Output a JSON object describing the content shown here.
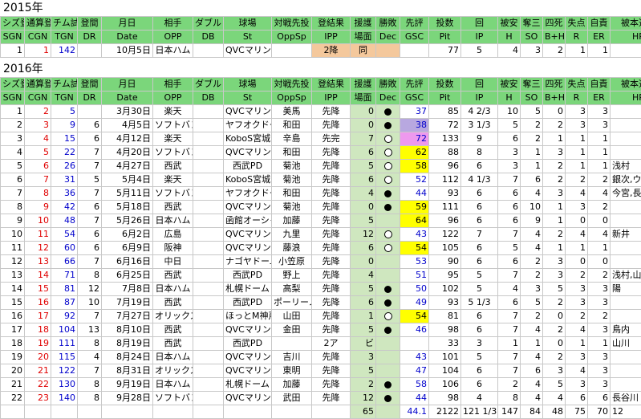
{
  "headings": {
    "y2015": "2015年",
    "y2016": "2016年"
  },
  "header_top": [
    "シズ登",
    "通算登",
    "チム試",
    "登間",
    "月日",
    "相手",
    "ダブル",
    "球場",
    "対戦先投",
    "登結果",
    "援護",
    "勝敗",
    "先評",
    "投数",
    "回",
    "被安",
    "奪三",
    "四死",
    "失点",
    "自責",
    "被本選手"
  ],
  "header_bottom": [
    "SGN",
    "CGN",
    "TGN",
    "DR",
    "Date",
    "OPP",
    "DB",
    "St",
    "OppSp",
    "IPP",
    "場面",
    "Dec",
    "GSC",
    "Pit",
    "IP",
    "H",
    "SO",
    "B+H",
    "R",
    "ER",
    "HR"
  ],
  "rows_2015": [
    {
      "sgn": "1",
      "cgn": "1",
      "tgn": "142",
      "dr": "",
      "date": "10月5日",
      "opp": "日本ハム",
      "db": "",
      "st": "QVCマリン",
      "oppsp": "",
      "ipp": "2降",
      "sc": "同",
      "dec": "",
      "gsc": "",
      "pit": "77",
      "ip": "5",
      "h": "4",
      "so": "3",
      "bh": "2",
      "r": "1",
      "er": "1",
      "hr": ""
    }
  ],
  "rows_2016": [
    {
      "sgn": "1",
      "cgn": "2",
      "tgn": "5",
      "dr": "",
      "date": "3月30日",
      "opp": "楽天",
      "db": "",
      "st": "QVCマリン",
      "oppsp": "美馬",
      "ipp": "先降",
      "sc": "0",
      "dec": "black",
      "gsc": "37",
      "gscbg": "",
      "pit": "85",
      "ip": "4 2/3",
      "h": "10",
      "so": "5",
      "bh": "0",
      "r": "3",
      "er": "3",
      "hr": ""
    },
    {
      "sgn": "2",
      "cgn": "3",
      "tgn": "9",
      "dr": "6",
      "date": "4月5日",
      "opp": "ソフトバンク",
      "db": "",
      "st": "ヤフオクドーム",
      "oppsp": "和田",
      "ipp": "先降",
      "sc": "0",
      "dec": "black",
      "gsc": "38",
      "gscbg": "lav",
      "pit": "72",
      "ip": "3 1/3",
      "h": "5",
      "so": "2",
      "bh": "2",
      "r": "3",
      "er": "3",
      "hr": ""
    },
    {
      "sgn": "3",
      "cgn": "4",
      "tgn": "15",
      "dr": "6",
      "date": "4月12日",
      "opp": "楽天",
      "db": "",
      "st": "KoboS宮城",
      "oppsp": "辛島",
      "ipp": "先完",
      "sc": "7",
      "dec": "white",
      "gsc": "72",
      "gscbg": "pink",
      "pit": "133",
      "ip": "9",
      "h": "6",
      "so": "2",
      "bh": "1",
      "r": "1",
      "er": "1",
      "hr": ""
    },
    {
      "sgn": "4",
      "cgn": "5",
      "tgn": "22",
      "dr": "7",
      "date": "4月20日",
      "opp": "ソフトバンク",
      "db": "",
      "st": "QVCマリン",
      "oppsp": "和田",
      "ipp": "先降",
      "sc": "6",
      "dec": "white",
      "gsc": "62",
      "gscbg": "yellow",
      "pit": "88",
      "ip": "8",
      "h": "3",
      "so": "1",
      "bh": "3",
      "r": "1",
      "er": "1",
      "hr": ""
    },
    {
      "sgn": "5",
      "cgn": "6",
      "tgn": "26",
      "dr": "7",
      "date": "4月27日",
      "opp": "西武",
      "db": "",
      "st": "西武PD",
      "oppsp": "菊池",
      "ipp": "先降",
      "sc": "5",
      "dec": "white",
      "gsc": "58",
      "gscbg": "yellow",
      "pit": "96",
      "ip": "6",
      "h": "3",
      "so": "1",
      "bh": "2",
      "r": "1",
      "er": "1",
      "hr": "浅村"
    },
    {
      "sgn": "6",
      "cgn": "7",
      "tgn": "31",
      "dr": "5",
      "date": "5月4日",
      "opp": "楽天",
      "db": "",
      "st": "KoboS宮城",
      "oppsp": "菊池",
      "ipp": "先降",
      "sc": "6",
      "dec": "white",
      "gsc": "52",
      "gscbg": "",
      "pit": "112",
      "ip": "4 1/3",
      "h": "7",
      "so": "6",
      "bh": "2",
      "r": "2",
      "er": "2",
      "hr": "銀次,ウィーラー"
    },
    {
      "sgn": "7",
      "cgn": "8",
      "tgn": "36",
      "dr": "7",
      "date": "5月11日",
      "opp": "ソフトバンク",
      "db": "",
      "st": "ヤフオクドーム",
      "oppsp": "和田",
      "ipp": "先降",
      "sc": "4",
      "dec": "black",
      "gsc": "44",
      "gscbg": "",
      "pit": "93",
      "ip": "6",
      "h": "6",
      "so": "4",
      "bh": "3",
      "r": "4",
      "er": "4",
      "hr": "今宮,長谷川"
    },
    {
      "sgn": "8",
      "cgn": "9",
      "tgn": "42",
      "dr": "6",
      "date": "5月18日",
      "opp": "西武",
      "db": "",
      "st": "QVCマリン",
      "oppsp": "菊池",
      "ipp": "先降",
      "sc": "0",
      "dec": "black",
      "gsc": "59",
      "gscbg": "yellow",
      "pit": "111",
      "ip": "6",
      "h": "6",
      "so": "10",
      "bh": "1",
      "r": "3",
      "er": "2",
      "hr": ""
    },
    {
      "sgn": "9",
      "cgn": "10",
      "tgn": "48",
      "dr": "7",
      "date": "5月26日",
      "opp": "日本ハム",
      "db": "",
      "st": "函館オーシャン",
      "oppsp": "加藤",
      "ipp": "先降",
      "sc": "5",
      "dec": "",
      "gsc": "64",
      "gscbg": "yellow",
      "pit": "96",
      "ip": "6",
      "h": "6",
      "so": "9",
      "bh": "1",
      "r": "0",
      "er": "0",
      "hr": ""
    },
    {
      "sgn": "10",
      "cgn": "11",
      "tgn": "54",
      "dr": "6",
      "date": "6月2日",
      "opp": "広島",
      "db": "",
      "st": "QVCマリン",
      "oppsp": "九里",
      "ipp": "先降",
      "sc": "12",
      "dec": "white",
      "gsc": "43",
      "gscbg": "",
      "pit": "122",
      "ip": "7",
      "h": "7",
      "so": "4",
      "bh": "2",
      "r": "4",
      "er": "4",
      "hr": "新井"
    },
    {
      "sgn": "11",
      "cgn": "12",
      "tgn": "60",
      "dr": "6",
      "date": "6月9日",
      "opp": "阪神",
      "db": "",
      "st": "QVCマリン",
      "oppsp": "藤浪",
      "ipp": "先降",
      "sc": "6",
      "dec": "white",
      "gsc": "54",
      "gscbg": "yellow",
      "pit": "105",
      "ip": "6",
      "h": "5",
      "so": "4",
      "bh": "1",
      "r": "1",
      "er": "1",
      "hr": ""
    },
    {
      "sgn": "12",
      "cgn": "13",
      "tgn": "66",
      "dr": "7",
      "date": "6月16日",
      "opp": "中日",
      "db": "",
      "st": "ナゴヤドーム",
      "oppsp": "小笠原",
      "ipp": "先降",
      "sc": "0",
      "dec": "",
      "gsc": "53",
      "gscbg": "",
      "pit": "90",
      "ip": "6",
      "h": "6",
      "so": "2",
      "bh": "3",
      "r": "0",
      "er": "0",
      "hr": ""
    },
    {
      "sgn": "13",
      "cgn": "14",
      "tgn": "71",
      "dr": "8",
      "date": "6月25日",
      "opp": "西武",
      "db": "",
      "st": "西武PD",
      "oppsp": "野上",
      "ipp": "先降",
      "sc": "4",
      "dec": "",
      "gsc": "51",
      "gscbg": "",
      "pit": "95",
      "ip": "5",
      "h": "7",
      "so": "2",
      "bh": "3",
      "r": "2",
      "er": "2",
      "hr": "浅村,山川"
    },
    {
      "sgn": "14",
      "cgn": "15",
      "tgn": "81",
      "dr": "12",
      "date": "7月8日",
      "opp": "日本ハム",
      "db": "",
      "st": "札幌ドーム",
      "oppsp": "高梨",
      "ipp": "先降",
      "sc": "5",
      "dec": "black",
      "gsc": "50",
      "gscbg": "",
      "pit": "102",
      "ip": "5",
      "h": "4",
      "so": "3",
      "bh": "5",
      "r": "3",
      "er": "3",
      "hr": "陽"
    },
    {
      "sgn": "15",
      "cgn": "16",
      "tgn": "87",
      "dr": "10",
      "date": "7月19日",
      "opp": "西武",
      "db": "",
      "st": "西武PD",
      "oppsp": "ポーリーノ",
      "ipp": "先降",
      "sc": "6",
      "dec": "black",
      "gsc": "49",
      "gscbg": "",
      "pit": "93",
      "ip": "5 1/3",
      "h": "6",
      "so": "5",
      "bh": "2",
      "r": "3",
      "er": "3",
      "hr": ""
    },
    {
      "sgn": "16",
      "cgn": "17",
      "tgn": "92",
      "dr": "7",
      "date": "7月27日",
      "opp": "オリックス",
      "db": "",
      "st": "ほっとM神戸",
      "oppsp": "山田",
      "ipp": "先降",
      "sc": "1",
      "dec": "white",
      "gsc": "54",
      "gscbg": "yellow",
      "pit": "81",
      "ip": "6",
      "h": "7",
      "so": "2",
      "bh": "0",
      "r": "2",
      "er": "2",
      "hr": ""
    },
    {
      "sgn": "17",
      "cgn": "18",
      "tgn": "104",
      "dr": "13",
      "date": "8月10日",
      "opp": "西武",
      "db": "",
      "st": "QVCマリン",
      "oppsp": "金田",
      "ipp": "先降",
      "sc": "5",
      "dec": "black",
      "gsc": "46",
      "gscbg": "",
      "pit": "98",
      "ip": "6",
      "h": "7",
      "so": "4",
      "bh": "2",
      "r": "4",
      "er": "3",
      "hr": "鳥内"
    },
    {
      "sgn": "18",
      "cgn": "19",
      "tgn": "111",
      "dr": "8",
      "date": "8月19日",
      "opp": "西武",
      "db": "",
      "st": "西武PD",
      "oppsp": "",
      "ipp": "2ア",
      "sc": "ビ",
      "dec": "",
      "gsc": "",
      "gscbg": "",
      "pit": "33",
      "ip": "3",
      "h": "1",
      "so": "1",
      "bh": "0",
      "r": "1",
      "er": "1",
      "hr": "山川"
    },
    {
      "sgn": "19",
      "cgn": "20",
      "tgn": "115",
      "dr": "4",
      "date": "8月24日",
      "opp": "日本ハム",
      "db": "",
      "st": "QVCマリン",
      "oppsp": "吉川",
      "ipp": "先降",
      "sc": "3",
      "dec": "",
      "gsc": "43",
      "gscbg": "",
      "pit": "101",
      "ip": "5",
      "h": "7",
      "so": "4",
      "bh": "2",
      "r": "3",
      "er": "3",
      "hr": ""
    },
    {
      "sgn": "20",
      "cgn": "21",
      "tgn": "122",
      "dr": "7",
      "date": "8月31日",
      "opp": "オリックス",
      "db": "",
      "st": "QVCマリン",
      "oppsp": "東明",
      "ipp": "先降",
      "sc": "5",
      "dec": "",
      "gsc": "47",
      "gscbg": "",
      "pit": "104",
      "ip": "6",
      "h": "7",
      "so": "6",
      "bh": "3",
      "r": "4",
      "er": "3",
      "hr": ""
    },
    {
      "sgn": "21",
      "cgn": "22",
      "tgn": "130",
      "dr": "8",
      "date": "9月19日",
      "opp": "日本ハム",
      "db": "",
      "st": "札幌ドーム",
      "oppsp": "加藤",
      "ipp": "先降",
      "sc": "2",
      "dec": "black",
      "gsc": "58",
      "gscbg": "",
      "pit": "106",
      "ip": "6",
      "h": "2",
      "so": "4",
      "bh": "5",
      "r": "3",
      "er": "3",
      "hr": ""
    },
    {
      "sgn": "22",
      "cgn": "23",
      "tgn": "140",
      "dr": "8",
      "date": "9月28日",
      "opp": "ソフトバンク",
      "db": "",
      "st": "QVCマリン",
      "oppsp": "武田",
      "ipp": "先降",
      "sc": "12",
      "dec": "black",
      "gsc": "44",
      "gscbg": "",
      "pit": "98",
      "ip": "4",
      "h": "8",
      "so": "4",
      "bh": "4",
      "r": "6",
      "er": "6",
      "hr": "長谷川"
    }
  ],
  "totals_2016": {
    "sc": "65",
    "gsc": "44.1",
    "pit": "2122",
    "ip": "121 1/3",
    "h": "147",
    "so": "84",
    "bh": "48",
    "r": "75",
    "er": "70",
    "hr": "12"
  }
}
